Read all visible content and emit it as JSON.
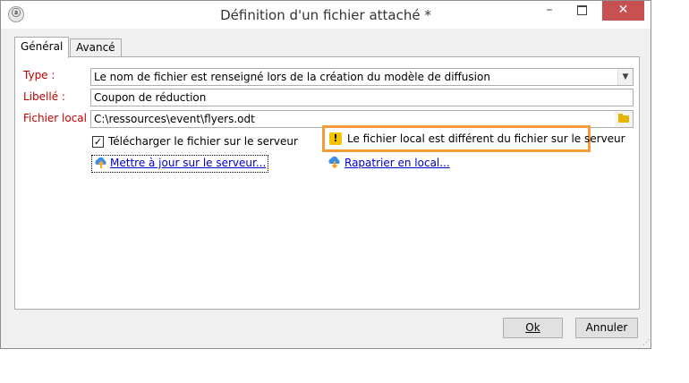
{
  "window": {
    "title": "Définition d'un fichier attaché *",
    "app_icon": "ⓐ"
  },
  "titlebar": {
    "minimize": "–",
    "close": "✕"
  },
  "tabs": [
    {
      "label": "Général",
      "active": true
    },
    {
      "label": "Avancé",
      "active": false
    }
  ],
  "form": {
    "type_label": "Type :",
    "type_value": "Le nom de fichier est renseigné lors de la création du modèle de diffusion",
    "libelle_label": "Libellé :",
    "libelle_value": "Coupon de réduction",
    "fichier_label": "Fichier local :",
    "fichier_value": "C:\\ressources\\event\\flyers.odt",
    "checkbox_label": "Télécharger le fichier sur le serveur",
    "checkbox_checked": true
  },
  "warning": {
    "icon": "!",
    "text": "Le fichier local est différent du fichier sur le serveur"
  },
  "links": {
    "update": "Mettre à jour sur le serveur...",
    "local": "Rapatrier en local..."
  },
  "buttons": {
    "ok": "Ok",
    "cancel": "Annuler"
  },
  "icons": {
    "app": "app-icon",
    "folder": "folder-icon",
    "warning": "warning-icon",
    "upload": "cloud-upload-icon",
    "download": "cloud-download-icon"
  },
  "colors": {
    "required_label": "#c00000",
    "warning_border": "#f39c3b",
    "link": "#0000cc",
    "close_button": "#c75050"
  }
}
